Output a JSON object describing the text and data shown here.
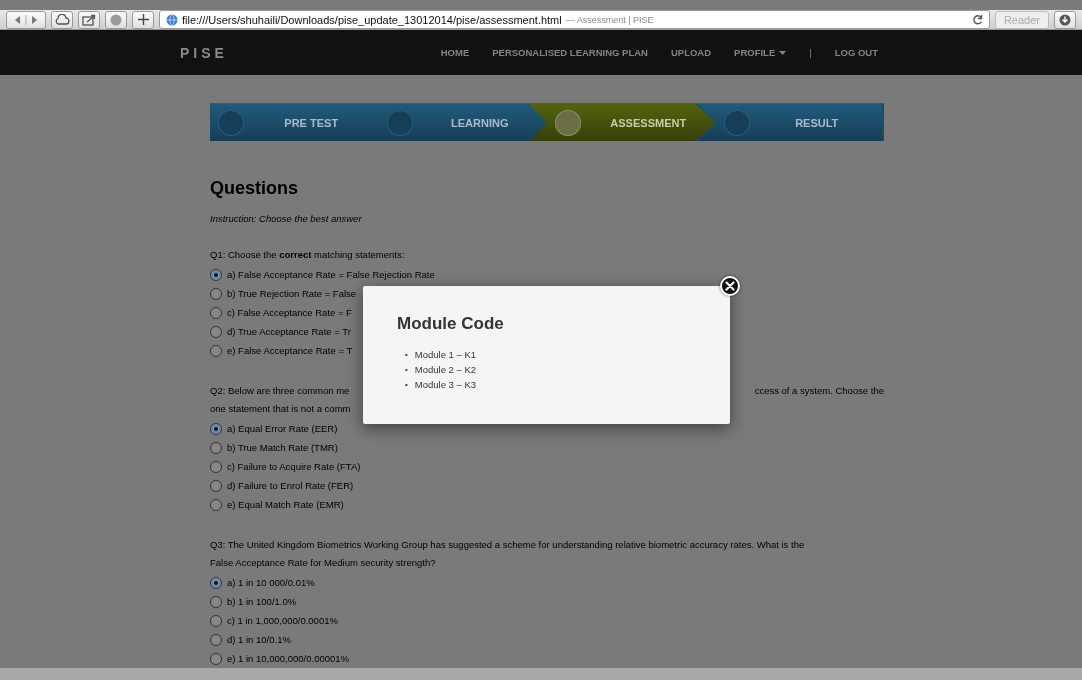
{
  "browser": {
    "url": "file:///Users/shuhaili/Downloads/pise_update_13012014/pise/assessment.html",
    "page_title": "— Assessment | PISE",
    "reader": "Reader"
  },
  "nav": {
    "brand": "PISE",
    "items": [
      {
        "label": "HOME",
        "kind": "link"
      },
      {
        "label": "PERSONALISED LEARNING PLAN",
        "kind": "link"
      },
      {
        "label": "UPLOAD",
        "kind": "link"
      },
      {
        "label": "PROFILE",
        "kind": "dropdown"
      },
      {
        "label": "|",
        "kind": "divider"
      },
      {
        "label": "LOG OUT",
        "kind": "link"
      }
    ]
  },
  "steps": [
    {
      "label": "PRE TEST",
      "selected": false
    },
    {
      "label": "LEARNING",
      "selected": false
    },
    {
      "label": "ASSESSMENT",
      "selected": true
    },
    {
      "label": "RESULT",
      "selected": false
    }
  ],
  "heading": "Questions",
  "instruction": "Instruction: Choose the best answer",
  "questions": [
    {
      "prompt_lines": [
        [
          "Q1: Choose the **correct** matching statements:"
        ]
      ],
      "options": [
        {
          "label": "a) False Acceptance Rate = False Rejection Rate",
          "selected": true
        },
        {
          "label": "b) True Rejection Rate = False",
          "selected": false
        },
        {
          "label": "c) False Acceptance Rate = F",
          "selected": false
        },
        {
          "label": "d) True Acceptance Rate = Tr",
          "selected": false
        },
        {
          "label": "e) False Acceptance Rate = T",
          "selected": false
        }
      ]
    },
    {
      "prompt_lines": [
        [
          "Q2: Below are three common me",
          "ccess of a system. Choose the"
        ],
        [
          "one statement that is not a comm"
        ]
      ],
      "options": [
        {
          "label": "a) Equal Error Rate (EER)",
          "selected": true
        },
        {
          "label": "b) True Match Rate (TMR)",
          "selected": false
        },
        {
          "label": "c) Failure to Acquire Rate (FTA)",
          "selected": false
        },
        {
          "label": "d) Failure to Enrol Rate (FER)",
          "selected": false
        },
        {
          "label": "e) Equal Match Rate (EMR)",
          "selected": false
        }
      ]
    },
    {
      "prompt_lines": [
        [
          "Q3: The United Kingdom Biometrics Working Group has suggested a scheme for understanding relative biometric accuracy rates. What is the"
        ],
        [
          "False Acceptance Rate for Medium security strength?"
        ]
      ],
      "options": [
        {
          "label": "a) 1 in 10 000/0.01%",
          "selected": true
        },
        {
          "label": "b) 1 in 100/1.0%",
          "selected": false
        },
        {
          "label": "c) 1 in 1,000,000/0.0001%",
          "selected": false
        },
        {
          "label": "d) 1 in 10/0.1%",
          "selected": false
        },
        {
          "label": "e) 1 in 10,000,000/0.00001%",
          "selected": false
        }
      ]
    }
  ],
  "modal": {
    "title": "Module Code",
    "bullet": "•",
    "items": [
      "Module 1 – K1",
      "Module 2 – K2",
      "Module 3 – K3"
    ]
  }
}
